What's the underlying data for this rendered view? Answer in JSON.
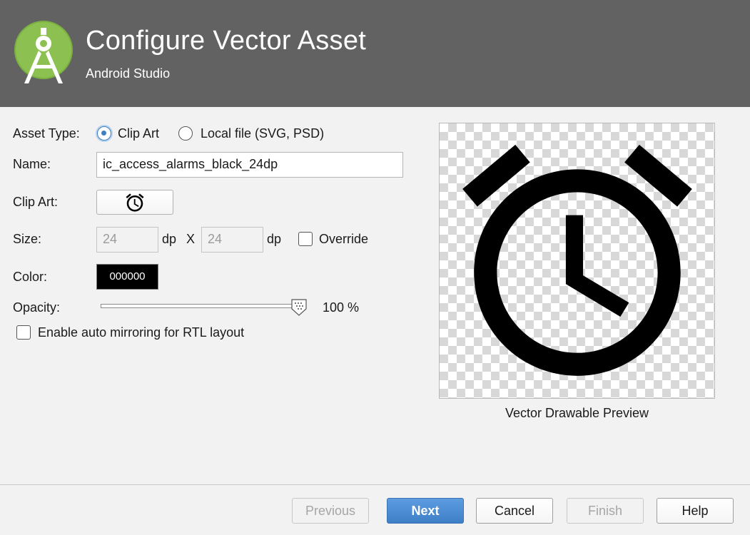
{
  "header": {
    "title": "Configure Vector Asset",
    "subtitle": "Android Studio",
    "logo_icon": "android-studio-logo-icon",
    "background": "#626262"
  },
  "form": {
    "asset_type_label": "Asset Type:",
    "asset_type_options": [
      {
        "label": "Clip Art",
        "selected": true
      },
      {
        "label": "Local file (SVG, PSD)",
        "selected": false
      }
    ],
    "name_label": "Name:",
    "name_value": "ic_access_alarms_black_24dp",
    "clip_art_label": "Clip Art:",
    "clip_art_icon": "alarm-clock-icon",
    "size_label": "Size:",
    "width_value": "24",
    "width_unit": "dp",
    "size_separator": "X",
    "height_value": "24",
    "height_unit": "dp",
    "override_label": "Override",
    "override_checked": false,
    "color_label": "Color:",
    "color_value": "000000",
    "opacity_label": "Opacity:",
    "opacity_value": "100 %",
    "opacity_fraction": 1.0,
    "auto_mirror_label": "Enable auto mirroring for RTL layout",
    "auto_mirror_checked": false
  },
  "preview": {
    "label": "Vector Drawable Preview",
    "icon": "alarm-clock-icon"
  },
  "buttons": {
    "previous": "Previous",
    "next": "Next",
    "cancel": "Cancel",
    "finish": "Finish",
    "help": "Help"
  },
  "colors": {
    "accent": "#3f7fc7",
    "header_bg": "#626262",
    "logo_green": "#8bc34a"
  }
}
